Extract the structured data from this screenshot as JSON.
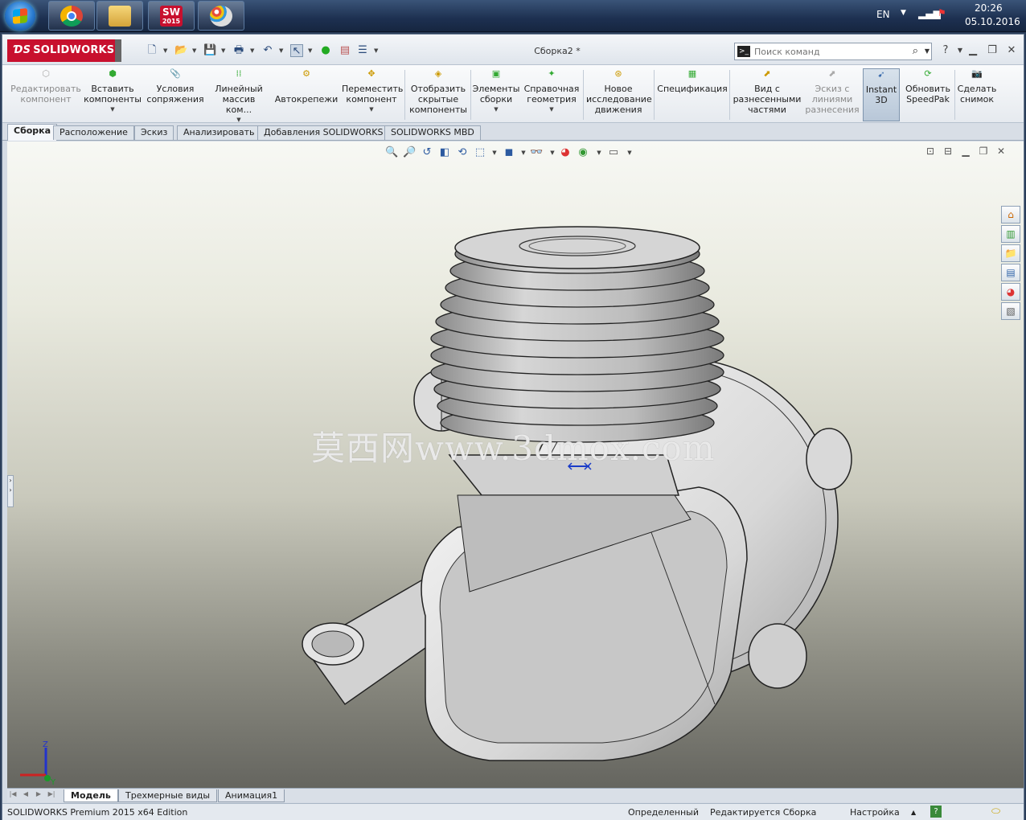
{
  "taskbar": {
    "start_label": "Start",
    "lang": "EN",
    "time": "20:26",
    "date": "05.10.2016",
    "apps": [
      "chrome-icon",
      "explorer-icon",
      "solidworks-2015-icon",
      "paint-icon"
    ],
    "sw_badge": "2015"
  },
  "app": {
    "brand": "SOLIDWORKS",
    "title": "Сборка2 *",
    "search_placeholder": "Поиск команд"
  },
  "ribbon": {
    "items": [
      {
        "label": "Редактировать компонент",
        "enabled": false
      },
      {
        "label": "Вставить компоненты",
        "enabled": true
      },
      {
        "label": "Условия сопряжения",
        "enabled": true
      },
      {
        "label": "Линейный массив ком...",
        "enabled": true
      },
      {
        "label": "Автокрепежи",
        "enabled": true
      },
      {
        "label": "Переместить компонент",
        "enabled": true
      },
      {
        "label": "Отобразить скрытые компоненты",
        "enabled": true
      },
      {
        "label": "Элементы сборки",
        "enabled": true
      },
      {
        "label": "Справочная геометрия",
        "enabled": true
      },
      {
        "label": "Новое исследование движения",
        "enabled": true
      },
      {
        "label": "Спецификация",
        "enabled": true
      },
      {
        "label": "Вид с разнесенными частями",
        "enabled": true
      },
      {
        "label": "Эскиз с линиями разнесения",
        "enabled": false
      },
      {
        "label": "Instant 3D",
        "enabled": true
      },
      {
        "label": "Обновить SpeedPak",
        "enabled": true
      },
      {
        "label": "Сделать снимок",
        "enabled": true
      }
    ]
  },
  "tabs": [
    "Сборка",
    "Расположение",
    "Эскиз",
    "Анализировать",
    "Добавления SOLIDWORKS",
    "SOLIDWORKS MBD"
  ],
  "viewport": {
    "watermark": "莫西网www.3dmox.com",
    "triad": {
      "z": "Z",
      "y": "Y"
    }
  },
  "bottom_tabs": [
    "Модель",
    "Трехмерные виды",
    "Анимация1"
  ],
  "status": {
    "edition": "SOLIDWORKS Premium 2015 x64 Edition",
    "state": "Определенный",
    "editing": "Редактируется Сборка",
    "setting": "Настройка"
  },
  "colors": {
    "accent": "#c8102e",
    "taskbar": "#1d3050",
    "viewport_top": "#f7f8f4",
    "viewport_bottom": "#65655f"
  }
}
